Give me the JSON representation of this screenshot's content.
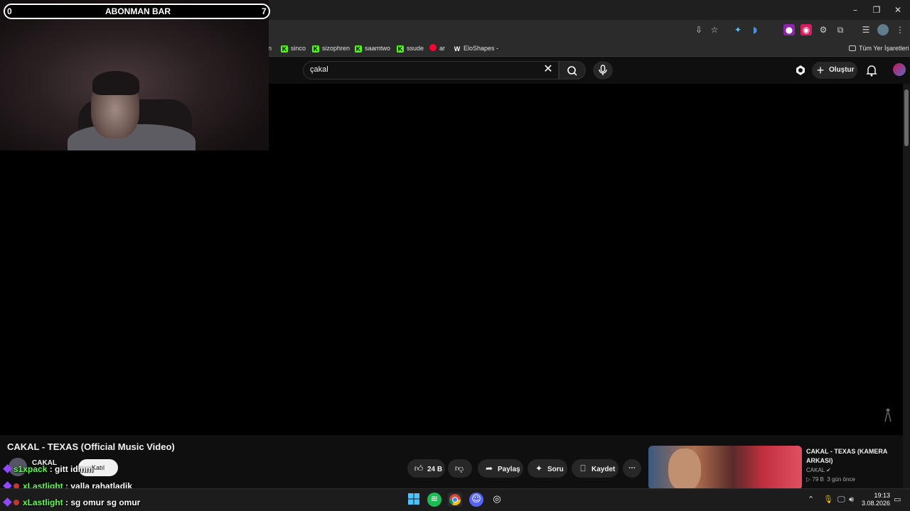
{
  "browser": {
    "window_controls": {
      "minimize": "–",
      "maximize": "❐",
      "close": "✕"
    },
    "bookmarks": [
      {
        "label": "n",
        "favicon": "none"
      },
      {
        "label": "sinco",
        "favicon": "kick"
      },
      {
        "label": "sizophren",
        "favicon": "kick"
      },
      {
        "label": "saamtwo",
        "favicon": "kick"
      },
      {
        "label": "ssude",
        "favicon": "kick"
      },
      {
        "label": "ar",
        "favicon": "youtube"
      },
      {
        "label": "EloShapes -",
        "favicon": "eloshapes"
      }
    ],
    "all_bookmarks_label": "Tüm Yer İşaretleri"
  },
  "youtube": {
    "search": {
      "value": "çakal"
    },
    "create_label": "Oluştur",
    "video": {
      "title": "CAKAL - TEXAS (Official Music Video)",
      "channel": "CAKAL",
      "join_label": "Katıl",
      "like_count": "24 B",
      "share_label": "Paylaş",
      "ask_label": "Soru",
      "save_label": "Kaydet"
    },
    "recommendation": {
      "title": "CAKAL - TEXAS (KAMERA ARKASI)",
      "channel": "CAKAL",
      "views": "79 B",
      "age": "3 gün önce"
    }
  },
  "stream_overlay": {
    "subscriber_bar": {
      "min": "0",
      "title": "ABONMAN BAR",
      "max": "7"
    },
    "chat": [
      {
        "user": "s1xpack",
        "message": "gitt idmm"
      },
      {
        "user": "xLastlight",
        "message": "valla rahatladik"
      },
      {
        "user": "xLastlight",
        "message": "sg omur sg omur"
      }
    ]
  },
  "taskbar": {
    "time": "19:13",
    "date": "3.08.2026"
  },
  "colors": {
    "accent_chat_user": "#33e0ff",
    "kick_green": "#53fc18",
    "youtube_red": "#ff0033"
  }
}
